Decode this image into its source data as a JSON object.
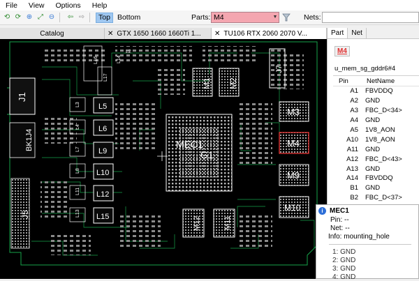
{
  "menu": [
    "File",
    "View",
    "Options",
    "Help"
  ],
  "toolbar": {
    "top_label": "Top",
    "bottom_label": "Bottom",
    "parts_label": "Parts:",
    "parts_value": "M4",
    "nets_label": "Nets:",
    "nets_value": ""
  },
  "tabs": [
    {
      "label": "Catalog",
      "closable": false
    },
    {
      "label": "GTX 1650 1660 1660Ti 1...",
      "closable": true
    },
    {
      "label": "TU106 RTX 2060 2070 V...",
      "closable": true
    }
  ],
  "side_tabs": [
    "Part",
    "Net"
  ],
  "part": {
    "badge": "M4",
    "name": "u_mem_sg_gddr6#4",
    "col_pin": "Pin",
    "col_net": "NetName",
    "pins": [
      {
        "pin": "A1",
        "net": "FBVDDQ"
      },
      {
        "pin": "A2",
        "net": "GND"
      },
      {
        "pin": "A3",
        "net": "FBC_D<34>"
      },
      {
        "pin": "A4",
        "net": "GND"
      },
      {
        "pin": "A5",
        "net": "1V8_AON"
      },
      {
        "pin": "A10",
        "net": "1V8_AON"
      },
      {
        "pin": "A11",
        "net": "GND"
      },
      {
        "pin": "A12",
        "net": "FBC_D<43>"
      },
      {
        "pin": "A13",
        "net": "GND"
      },
      {
        "pin": "A14",
        "net": "FBVDDQ"
      },
      {
        "pin": "B1",
        "net": "GND"
      },
      {
        "pin": "B2",
        "net": "FBC_D<37>"
      }
    ]
  },
  "popup": {
    "title": "MEC1",
    "pin": "Pin: --",
    "net": "Net: --",
    "info": "Info: mounting_hole",
    "list": [
      "1: GND",
      "2: GND",
      "3: GND",
      "4: GND"
    ]
  },
  "board": {
    "labels": [
      "J1",
      "BK1J4",
      "J5",
      "L5",
      "L6",
      "L9",
      "L10",
      "L12",
      "L15",
      "M1",
      "M2",
      "J7",
      "M3",
      "M4",
      "M9",
      "M10",
      "M12",
      "M11",
      "MEC1",
      "G1"
    ],
    "small_labels": [
      "L3",
      "L4",
      "L7",
      "L8",
      "L11",
      "L13",
      "L16",
      "L17",
      "L14",
      "L2"
    ]
  },
  "colors": {
    "board": "#000000",
    "trace": "#16a34a",
    "silkscreen": "#ffffff",
    "highlight": "#ff3b3b",
    "parts_field": "#f4a6b0",
    "active_view": "#9fc7f0"
  }
}
